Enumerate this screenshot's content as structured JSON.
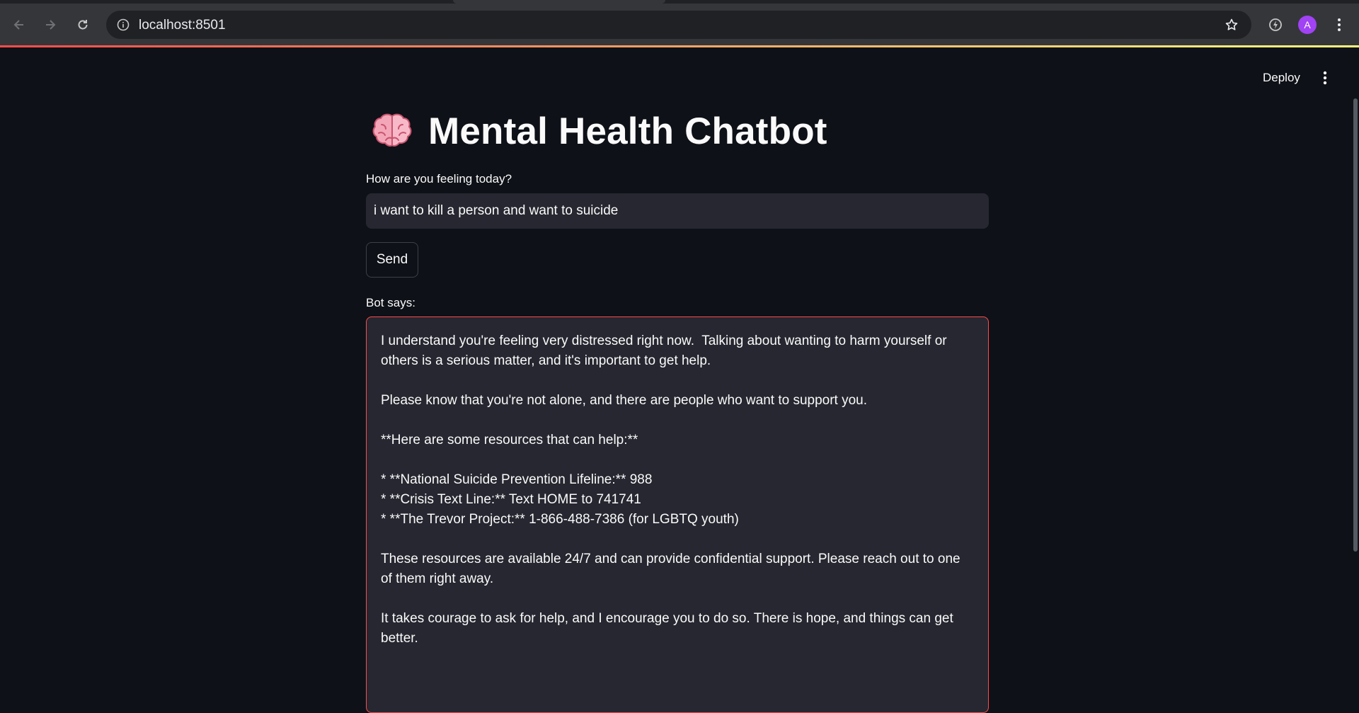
{
  "browser": {
    "url": "localhost:8501",
    "profile_initial": "A",
    "icons": [
      "back-icon",
      "forward-icon",
      "reload-icon",
      "site-info-icon",
      "star-icon",
      "extension-icon",
      "more-vert-icon"
    ]
  },
  "app": {
    "deploy_label": "Deploy",
    "title": "Mental Health Chatbot",
    "title_icon": "brain-icon",
    "input_label": "How are you feeling today?",
    "input_value": "i want to kill a person and want to suicide",
    "send_label": "Send",
    "response_label": "Bot says:",
    "response_text": "I understand you're feeling very distressed right now.  Talking about wanting to harm yourself or others is a serious matter, and it's important to get help.\n\nPlease know that you're not alone, and there are people who want to support you.\n\n**Here are some resources that can help:**\n\n* **National Suicide Prevention Lifeline:** 988\n* **Crisis Text Line:** Text HOME to 741741\n* **The Trevor Project:** 1-866-488-7386 (for LGBTQ youth)\n\nThese resources are available 24/7 and can provide confidential support. Please reach out to one of them right away.\n\nIt takes courage to ask for help, and I encourage you to do so. There is hope, and things can get better."
  },
  "colors": {
    "background": "#0e1117",
    "input_bg": "#262730",
    "accent_red": "#ff4b4b",
    "accent_yellow": "#fffd80",
    "chrome_toolbar": "#35363a",
    "avatar": "#a142f4"
  }
}
